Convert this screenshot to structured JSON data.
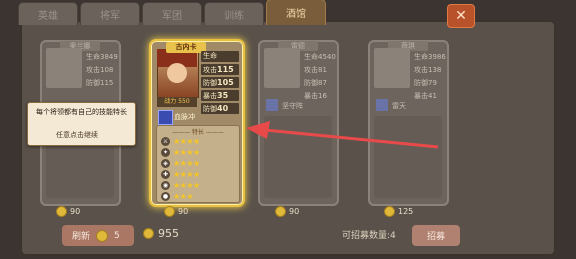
{
  "tabs": [
    {
      "label": "英雄"
    },
    {
      "label": "将军"
    },
    {
      "label": "军团"
    },
    {
      "label": "训练"
    },
    {
      "label": "酒馆"
    }
  ],
  "active_tab": "酒馆",
  "close_icon": "✕",
  "heroes": [
    {
      "name": "奥兰娜",
      "hp_label": "生命",
      "hp": "3849",
      "atk_label": "攻击",
      "atk": "108",
      "def_label": "防御",
      "def": "115",
      "skill": "",
      "cost": "90"
    },
    {
      "name": "古内卡",
      "hp_label": "生命",
      "hp": "5200",
      "atk_label": "攻击",
      "atk": "115",
      "def_label": "防御",
      "def": "105",
      "crit_label": "暴击",
      "crit": "35",
      "res_label": "防御",
      "res": "40",
      "power_label": "战力",
      "power": "550",
      "skill": "血脉冲",
      "trait_title": "——— 特长 ———",
      "cost": "90"
    },
    {
      "name": "雷德",
      "hp_label": "生命",
      "hp": "4540",
      "atk_label": "攻击",
      "atk": "81",
      "def_label": "防御",
      "def": "87",
      "crit_label": "暴击",
      "crit": "16",
      "skill": "坚守阵",
      "cost": "90"
    },
    {
      "name": "薇琪",
      "hp_label": "生命",
      "hp": "3986",
      "atk_label": "攻击",
      "atk": "138",
      "def_label": "防御",
      "def": "79",
      "crit_label": "暴击",
      "crit": "41",
      "skill": "雷天",
      "cost": "125"
    }
  ],
  "hero_traits_stars": [
    "★★★★",
    "★★★★",
    "★★★★",
    "★★★★",
    "★★★★",
    "★★★"
  ],
  "tooltip": {
    "text": "每个将领都有自己的技能特长",
    "hint": "任意点击继续"
  },
  "bottom": {
    "refresh_label": "刷新",
    "refresh_cost": "5",
    "gold": "955",
    "recruit_count_text": "可招募数量:4",
    "recruit_label": "招募"
  },
  "colors": {
    "highlight_border": "#e8c040",
    "arrow": "#e84a4a"
  }
}
